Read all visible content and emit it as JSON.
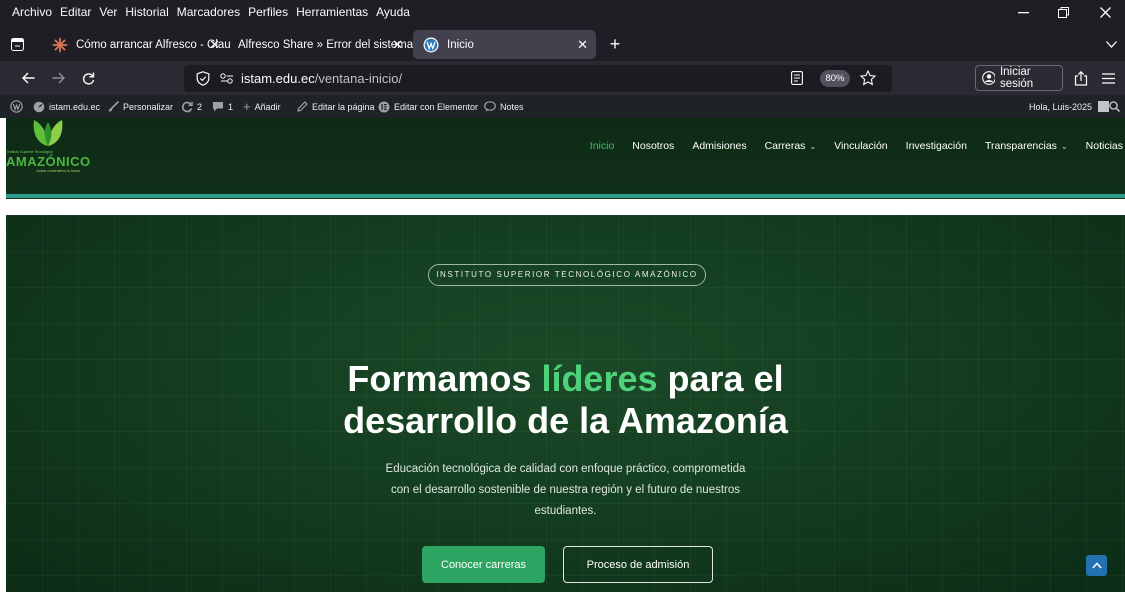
{
  "menubar": {
    "items": [
      "Archivo",
      "Editar",
      "Ver",
      "Historial",
      "Marcadores",
      "Perfiles",
      "Herramientas",
      "Ayuda"
    ]
  },
  "tabs": [
    {
      "title": "Cómo arrancar Alfresco - Claud",
      "icon": "claude-icon"
    },
    {
      "title": "Alfresco Share » Error del sistema",
      "icon": "none"
    },
    {
      "title": "Inicio",
      "icon": "wordpress-icon"
    }
  ],
  "navbar": {
    "url_host": "istam.edu.ec",
    "url_path": "/ventana-inicio/",
    "zoom": "80%",
    "signin_label": "Iniciar sesión"
  },
  "adminbar": {
    "site": "istam.edu.ec",
    "customize": "Personalizar",
    "updates": "2",
    "comments": "1",
    "add": "Añadir",
    "edit_page": "Editar la página",
    "edit_elementor": "Editar con Elementor",
    "notes": "Notes",
    "greeting": "Hola, Luis-2025"
  },
  "site": {
    "logo_small": "Instituto Superior Tecnológico",
    "logo_name": "AMAZÓNICO",
    "logo_tag": "Juntos construimos tu futuro",
    "nav": [
      "Inicio",
      "Nosotros",
      "Admisiones",
      "Carreras",
      "Vinculación",
      "Investigación",
      "Transparencias",
      "Noticias"
    ]
  },
  "hero": {
    "pill": "INSTITUTO SUPERIOR TECNOLÓGICO AMAZÓNICO",
    "title_a": "Formamos ",
    "title_hl": "líderes",
    "title_b": " para el",
    "title_line2": "desarrollo de la Amazonía",
    "subtitle_1": "Educación tecnológica de calidad con enfoque práctico, comprometida",
    "subtitle_2": "con el desarrollo sostenible de nuestra región y el futuro de nuestros",
    "subtitle_3": "estudiantes.",
    "btn_primary": "Conocer carreras",
    "btn_secondary": "Proceso de admisión"
  },
  "colors": {
    "accent_green": "#4fd07a",
    "button_green": "#2ea463",
    "header_bg": "#0e2a16",
    "header_line": "#2d9d8e"
  }
}
